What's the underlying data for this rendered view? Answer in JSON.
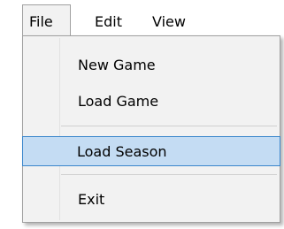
{
  "menubar": {
    "file_label": "File",
    "edit_label": "Edit",
    "view_label": "View"
  },
  "file_menu": {
    "items": [
      {
        "label": "New Game",
        "highlighted": false
      },
      {
        "label": "Load Game",
        "highlighted": false
      },
      {
        "label": "Load Season",
        "highlighted": true
      },
      {
        "label": "Exit",
        "highlighted": false
      }
    ]
  },
  "colors": {
    "highlight_fill": "#c4dcf3",
    "highlight_border": "#3a86cc",
    "menu_background": "#f2f2f2",
    "menu_border": "#a0a0a0"
  }
}
